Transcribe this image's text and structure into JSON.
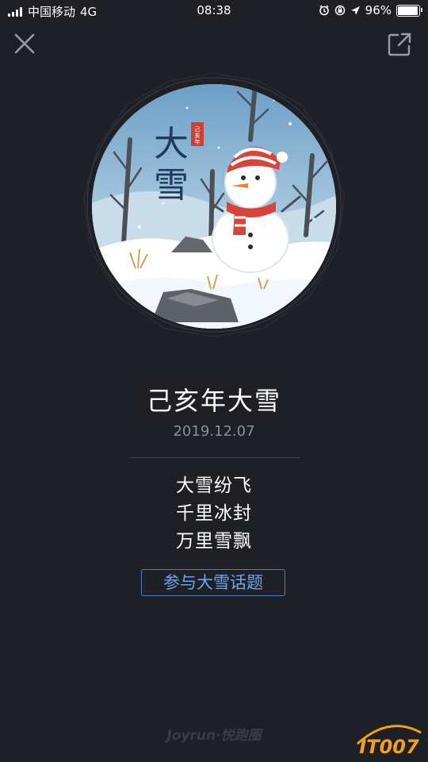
{
  "status_bar": {
    "carrier": "中国移动",
    "network": "4G",
    "time": "08:38",
    "battery_percent": "96%",
    "battery_level": 0.96
  },
  "icons": {
    "close": "close-icon",
    "share": "share-icon",
    "alarm": "alarm-icon",
    "rotation_lock": "rotation-lock-icon",
    "location": "location-icon"
  },
  "artwork": {
    "vertical_text": "大雪",
    "seal_text": "己亥年"
  },
  "poem": {
    "title": "己亥年大雪",
    "date": "2019.12.07",
    "lines": [
      "大雪纷飞",
      "千里冰封",
      "万里雪飘"
    ]
  },
  "topic_button": "参与大雪话题",
  "footer": {
    "logo_text": "Joyrun·悦跑圈"
  },
  "watermark": {
    "text": "IT007"
  },
  "colors": {
    "background": "#1f2026",
    "accent_blue": "#6ea4ea",
    "date_gray": "#8c8e95",
    "watermark_orange": "#f0a020"
  }
}
